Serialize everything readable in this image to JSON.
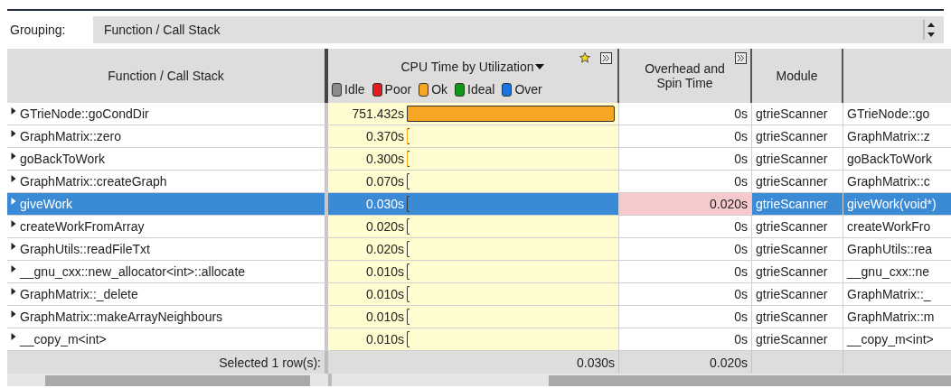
{
  "grouping": {
    "label": "Grouping:",
    "value": "Function / Call Stack"
  },
  "columns": {
    "function": "Function / Call Stack",
    "cpu": "CPU Time by Utilization",
    "overhead": "Overhead and Spin Time",
    "module": "Module"
  },
  "legend": [
    {
      "label": "Idle",
      "color": "#8c8c8c"
    },
    {
      "label": "Poor",
      "color": "#e41a1c"
    },
    {
      "label": "Ok",
      "color": "#f5a623"
    },
    {
      "label": "Ideal",
      "color": "#109618"
    },
    {
      "label": "Over",
      "color": "#1a75e0"
    }
  ],
  "rows": [
    {
      "function": "GTrieNode::goCondDir",
      "cpu": "751.432s",
      "level": 1,
      "overhead": "0s",
      "overhead_alert": false,
      "module": "gtrieScanner",
      "column_6": "GTrieNode::go",
      "selected": false
    },
    {
      "function": "GraphMatrix::zero",
      "cpu": "0.370s",
      "level": 0.0005,
      "overhead": "0s",
      "overhead_alert": false,
      "module": "gtrieScanner",
      "column_6": "GraphMatrix::z",
      "selected": false
    },
    {
      "function": "goBackToWork",
      "cpu": "0.300s",
      "level": 0.0004,
      "overhead": "0s",
      "overhead_alert": false,
      "module": "gtrieScanner",
      "column_6": "goBackToWork",
      "selected": false
    },
    {
      "function": "GraphMatrix::createGraph",
      "cpu": "0.070s",
      "level": 0.0001,
      "overhead": "0s",
      "overhead_alert": false,
      "module": "gtrieScanner",
      "column_6": "GraphMatrix::c",
      "selected": false
    },
    {
      "function": "giveWork",
      "cpu": "0.030s",
      "level": 4e-05,
      "overhead": "0.020s",
      "overhead_alert": true,
      "module": "gtrieScanner",
      "column_6": "giveWork(void*)",
      "selected": true
    },
    {
      "function": "createWorkFromArray",
      "cpu": "0.020s",
      "level": 3e-05,
      "overhead": "0s",
      "overhead_alert": false,
      "module": "gtrieScanner",
      "column_6": "createWorkFro",
      "selected": false
    },
    {
      "function": "GraphUtils::readFileTxt",
      "cpu": "0.020s",
      "level": 3e-05,
      "overhead": "0s",
      "overhead_alert": false,
      "module": "gtrieScanner",
      "column_6": "GraphUtils::rea",
      "selected": false
    },
    {
      "function": "__gnu_cxx::new_allocator<int>::allocate",
      "cpu": "0.010s",
      "level": 1e-05,
      "overhead": "0s",
      "overhead_alert": false,
      "module": "gtrieScanner",
      "column_6": "__gnu_cxx::ne",
      "selected": false
    },
    {
      "function": "GraphMatrix::_delete",
      "cpu": "0.010s",
      "level": 1e-05,
      "overhead": "0s",
      "overhead_alert": false,
      "module": "gtrieScanner",
      "column_6": "GraphMatrix::_",
      "selected": false
    },
    {
      "function": "GraphMatrix::makeArrayNeighbours",
      "cpu": "0.010s",
      "level": 1e-05,
      "overhead": "0s",
      "overhead_alert": false,
      "module": "gtrieScanner",
      "column_6": "GraphMatrix::m",
      "selected": false
    },
    {
      "function": "__copy_m<int>",
      "cpu": "0.010s",
      "level": 1e-05,
      "overhead": "0s",
      "overhead_alert": false,
      "module": "gtrieScanner",
      "column_6": "__copy_m<int>",
      "selected": false
    }
  ],
  "footer": {
    "label": "Selected 1 row(s):",
    "cpu": "0.030s",
    "overhead": "0.020s"
  }
}
